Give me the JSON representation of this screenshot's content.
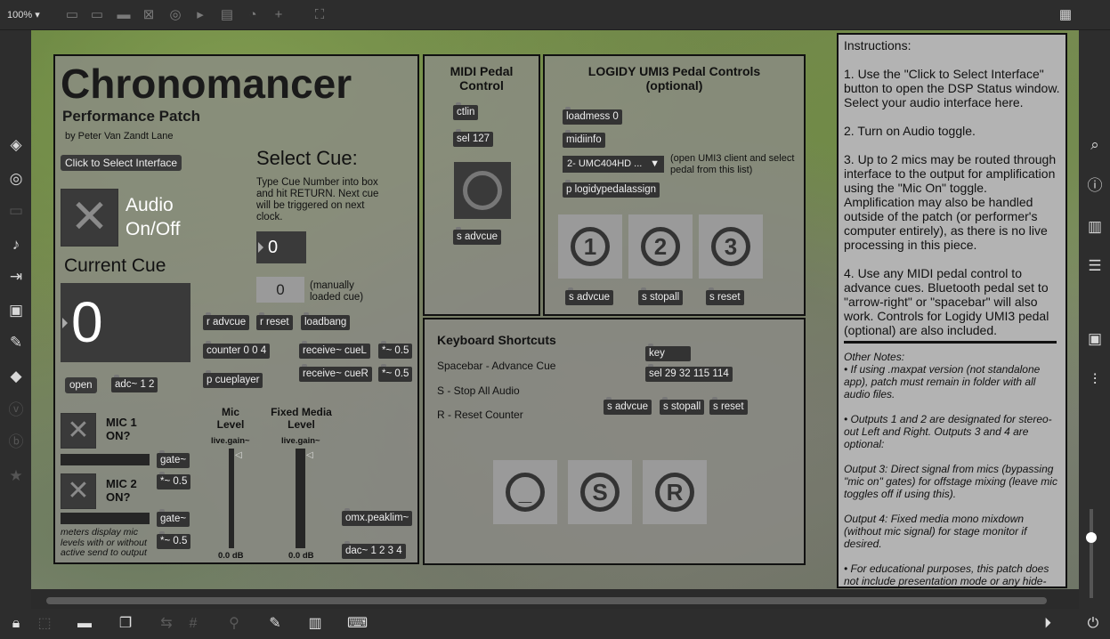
{
  "toolbar": {
    "zoom": "100%"
  },
  "patch": {
    "title": "Chronomancer",
    "subtitle": "Performance Patch",
    "author": "by Peter Van Zandt Lane",
    "select_interface_label": "Click to Select Interface",
    "audio_label_1": "Audio",
    "audio_label_2": "On/Off",
    "current_cue_label": "Current Cue",
    "current_cue_value": "0",
    "select_cue_title": "Select Cue:",
    "select_cue_help": "Type Cue Number into box and hit RETURN. Next cue will be triggered on next clock.",
    "cue_input_value": "0",
    "manual_cue_value": "0",
    "manual_cue_note": "(manually loaded cue)",
    "open_label": "open",
    "adc_label": "adc~ 1 2",
    "r_advcue": "r advcue",
    "r_reset": "r reset",
    "loadbang": "loadbang",
    "counter": "counter 0 0 4",
    "receive_cueL": "receive~ cueL",
    "receive_cueR": "receive~ cueR",
    "gain_05_a": "*~ 0.5",
    "gain_05_b": "*~ 0.5",
    "p_cueplayer": "p cueplayer",
    "mic1_label": "MIC 1 ON?",
    "mic2_label": "MIC 2 ON?",
    "gate_1": "gate~",
    "gain_mic1": "*~ 0.5",
    "gate_2": "gate~",
    "gain_mic2": "*~ 0.5",
    "meters_note": "meters display mic levels with or without active send to output",
    "mic_level_label": "Mic Level",
    "fixed_media_label": "Fixed Media Level",
    "live_gain_1": "live.gain~",
    "live_gain_2": "live.gain~",
    "db_1": "0.0 dB",
    "db_2": "0.0 dB",
    "omx": "omx.peaklim~",
    "dac": "dac~ 1 2 3 4"
  },
  "midi": {
    "title": "MIDI Pedal Control",
    "ctlin": "ctlin",
    "sel127": "sel 127",
    "s_advcue": "s advcue"
  },
  "logidy": {
    "title": "LOGIDY UMI3 Pedal Controls (optional)",
    "loadmess": "loadmess 0",
    "midiinfo": "midiinfo",
    "device": "2- UMC404HD ...",
    "device_note": "(open UMI3 client and select pedal from this list)",
    "assign": "p logidypedalassign",
    "btn1": "1",
    "btn2": "2",
    "btn3": "3",
    "s_advcue": "s advcue",
    "s_stopall": "s stopall",
    "s_reset": "s reset"
  },
  "keyboard": {
    "title": "Keyboard Shortcuts",
    "line1": "Spacebar - Advance Cue",
    "line2": "S - Stop All Audio",
    "line3": "R - Reset Counter",
    "key": "key",
    "sel": "sel 29 32 115 114",
    "s_advcue": "s advcue",
    "s_stopall": "s stopall",
    "s_reset": "s reset",
    "btn_space": "_",
    "btn_s": "S",
    "btn_r": "R"
  },
  "instructions": {
    "heading": "Instructions:",
    "step1": "1. Use the \"Click to Select Interface\" button to open the DSP Status window. Select your audio interface here.",
    "step2": "2. Turn on Audio toggle.",
    "step3": "3. Up to 2 mics may be routed through interface to the output for amplification using the \"Mic On\" toggle. Amplification may also be handled outside of the patch (or performer's computer entirely), as there is no live processing in this piece.",
    "step4": "4. Use any MIDI pedal control to advance cues. Bluetooth pedal set to \"arrow-right\" or \"spacebar\" will also work. Controls for Logidy UMI3 pedal (optional) are also included.",
    "notes_heading": "Other Notes:",
    "note1": "• If using .maxpat version (not standalone app), patch must remain in folder with all audio files.",
    "note2": "• Outputs 1 and 2 are designated for stereo-out Left and Right. Outputs 3 and 4 are optional:",
    "note3": "Output 3: Direct signal from mics (bypassing \"mic on\" gates) for offstage mixing (leave mic toggles off if using this).",
    "note4": "Output 4: Fixed media mono mixdown (without mic signal) for stage monitor if desired.",
    "note5": "• For educational purposes, this patch does not include presentation mode or any hide-on-lock objects."
  }
}
